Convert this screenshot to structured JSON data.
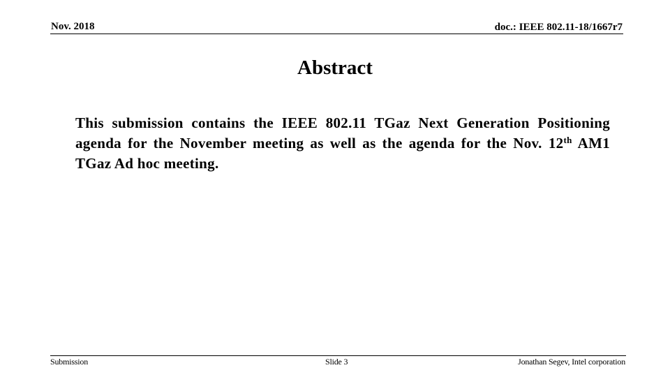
{
  "header": {
    "date": "Nov. 2018",
    "doc_id": "doc.: IEEE 802.11-18/1667r7"
  },
  "slide": {
    "title": "Abstract",
    "body": {
      "before_sup": "This submission contains the IEEE 802.11 TGaz Next Generation Positioning agenda for the November meeting as well as the agenda for the Nov. 12",
      "sup": "th",
      "after_sup": " AM1 TGaz Ad hoc meeting."
    }
  },
  "footer": {
    "left": "Submission",
    "center": "Slide 3",
    "right": "Jonathan Segev, Intel corporation"
  }
}
